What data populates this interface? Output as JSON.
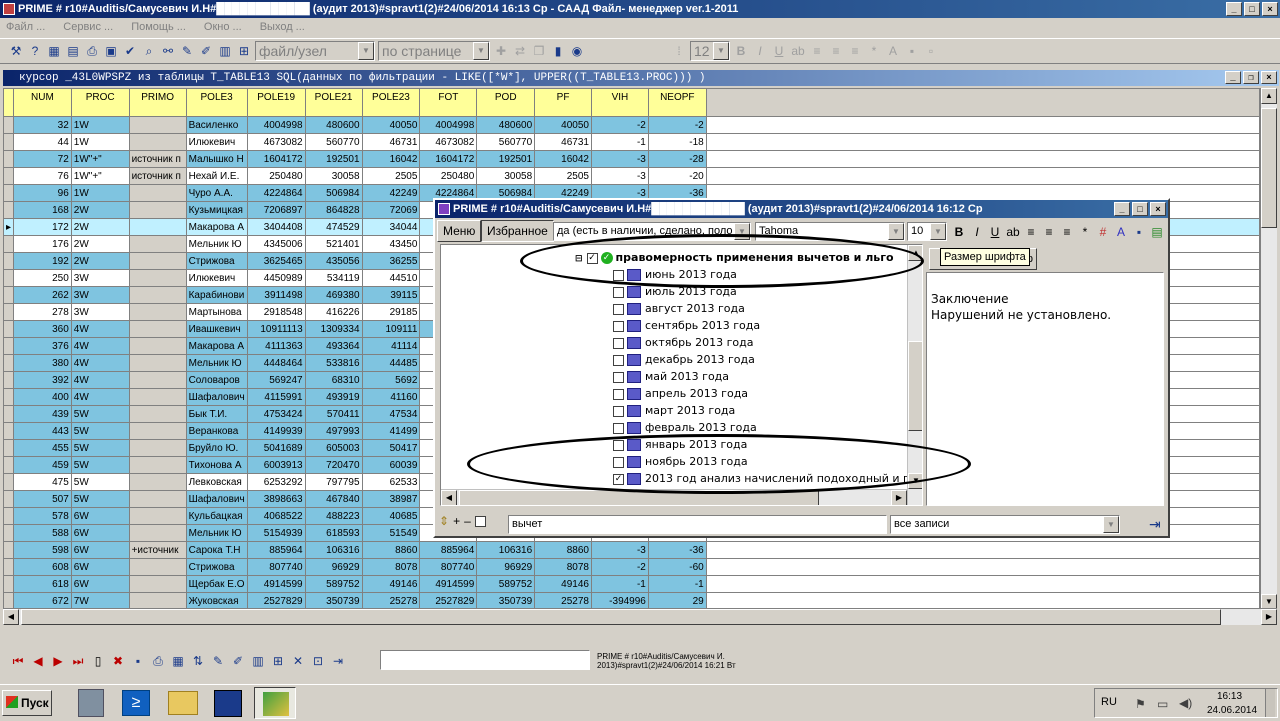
{
  "window": {
    "title": "PRIME # r10#Auditis/Самусевич И.Н#████████████ (аудит 2013)#spravt1(2)#24/06/2014 16:13 Ср - СААД Файл- менеджер ver.1-2011"
  },
  "menu": [
    "Файл ...",
    "Сервис ...",
    "Помощь ...",
    "Окно ...",
    "Выход ..."
  ],
  "toolbar": {
    "file_node": "файл/узел",
    "by_page": "по странице",
    "font_size": "12"
  },
  "mdi": {
    "title": "курсор _43L0WPSPZ из таблицы T_TABLE13 SQL(данных по фильтрации - LIKE([*W*], UPPER((T_TABLE13.PROC))) )"
  },
  "grid": {
    "columns": [
      "NUM",
      "PROC",
      "PRIMO",
      "POLE3",
      "POLE19",
      "POLE21",
      "POLE23",
      "FOT",
      "POD",
      "PF",
      "VIH",
      "NEOPF"
    ],
    "rows": [
      [
        "32",
        "1W",
        "",
        "Василенко",
        "4004998",
        "480600",
        "40050",
        "4004998",
        "480600",
        "40050",
        "-2",
        "-2"
      ],
      [
        "44",
        "1W",
        "",
        "Илюкевич",
        "4673082",
        "560770",
        "46731",
        "4673082",
        "560770",
        "46731",
        "-1",
        "-18"
      ],
      [
        "72",
        "1W\"+\"",
        "источник п",
        "Малышко Н",
        "1604172",
        "192501",
        "16042",
        "1604172",
        "192501",
        "16042",
        "-3",
        "-28"
      ],
      [
        "76",
        "1W\"+\"",
        "источник п",
        "Нехай И.Е.",
        "250480",
        "30058",
        "2505",
        "250480",
        "30058",
        "2505",
        "-3",
        "-20"
      ],
      [
        "96",
        "1W",
        "",
        "Чуро А.А.",
        "4224864",
        "506984",
        "42249",
        "4224864",
        "506984",
        "42249",
        "-3",
        "-36"
      ],
      [
        "168",
        "2W",
        "",
        "Кузьмицкая",
        "7206897",
        "864828",
        "72069",
        "",
        "",
        "",
        "",
        ""
      ],
      [
        "172",
        "2W",
        "",
        "Макарова А",
        "3404408",
        "474529",
        "34044",
        "",
        "",
        "",
        "",
        ""
      ],
      [
        "176",
        "2W",
        "",
        "Мельник Ю",
        "4345006",
        "521401",
        "43450",
        "",
        "",
        "",
        "",
        ""
      ],
      [
        "192",
        "2W",
        "",
        "Стрижова",
        "3625465",
        "435056",
        "36255",
        "",
        "",
        "",
        "",
        ""
      ],
      [
        "250",
        "3W",
        "",
        "Илюкевич",
        "4450989",
        "534119",
        "44510",
        "",
        "",
        "",
        "",
        ""
      ],
      [
        "262",
        "3W",
        "",
        "Карабинови",
        "3911498",
        "469380",
        "39115",
        "",
        "",
        "",
        "",
        ""
      ],
      [
        "278",
        "3W",
        "",
        "Мартынова",
        "2918548",
        "416226",
        "29185",
        "",
        "",
        "",
        "",
        ""
      ],
      [
        "360",
        "4W",
        "",
        "Ивашкевич",
        "10911113",
        "1309334",
        "109111",
        "1",
        "",
        "",
        "",
        ""
      ],
      [
        "376",
        "4W",
        "",
        "Макарова А",
        "4111363",
        "493364",
        "41114",
        "",
        "",
        "",
        "",
        ""
      ],
      [
        "380",
        "4W",
        "",
        "Мельник Ю",
        "4448464",
        "533816",
        "44485",
        "",
        "",
        "",
        "",
        ""
      ],
      [
        "392",
        "4W",
        "",
        "Соловаров",
        "569247",
        "68310",
        "5692",
        "",
        "",
        "",
        "",
        ""
      ],
      [
        "400",
        "4W",
        "",
        "Шафалович",
        "4115991",
        "493919",
        "41160",
        "",
        "",
        "",
        "",
        ""
      ],
      [
        "439",
        "5W",
        "",
        "Бык Т.И.",
        "4753424",
        "570411",
        "47534",
        "",
        "",
        "",
        "",
        ""
      ],
      [
        "443",
        "5W",
        "",
        "Веранкова",
        "4149939",
        "497993",
        "41499",
        "",
        "",
        "",
        "",
        ""
      ],
      [
        "455",
        "5W",
        "",
        "Бруйло Ю.",
        "5041689",
        "605003",
        "50417",
        "",
        "",
        "",
        "",
        ""
      ],
      [
        "459",
        "5W",
        "",
        "Тихонова А",
        "6003913",
        "720470",
        "60039",
        "",
        "",
        "",
        "",
        ""
      ],
      [
        "475",
        "5W",
        "",
        "Левковская",
        "6253292",
        "797795",
        "62533",
        "",
        "",
        "",
        "",
        ""
      ],
      [
        "507",
        "5W",
        "",
        "Шафалович",
        "3898663",
        "467840",
        "38987",
        "",
        "",
        "",
        "",
        ""
      ],
      [
        "578",
        "6W",
        "",
        "Кульбацкая",
        "4068522",
        "488223",
        "40685",
        "",
        "",
        "",
        "",
        ""
      ],
      [
        "588",
        "6W",
        "",
        "Мельник Ю",
        "5154939",
        "618593",
        "51549",
        "",
        "",
        "",
        "",
        ""
      ],
      [
        "598",
        "6W",
        "+источник",
        "Сарока Т.Н",
        "885964",
        "106316",
        "8860",
        "885964",
        "106316",
        "8860",
        "-3",
        "-36"
      ],
      [
        "608",
        "6W",
        "",
        "Стрижова",
        "807740",
        "96929",
        "8078",
        "807740",
        "96929",
        "8078",
        "-2",
        "-60"
      ],
      [
        "618",
        "6W",
        "",
        "Щербак Е.О",
        "4914599",
        "589752",
        "49146",
        "4914599",
        "589752",
        "49146",
        "-1",
        "-1"
      ],
      [
        "672",
        "7W",
        "",
        "Жуковская",
        "2527829",
        "350739",
        "25278",
        "2527829",
        "350739",
        "25278",
        "-394996",
        "29"
      ]
    ]
  },
  "dialog": {
    "title": "PRIME # r10#Auditis/Самусевич И.Н#████████████ (аудит 2013)#spravt1(2)#24/06/2014 16:12 Ср",
    "tab_menu": "Меню",
    "tab_favorites": "Избранное",
    "combo_value": "да (есть в наличии, сделано, поло",
    "font_name": "Tahoma",
    "font_size": "10",
    "tooltip": "Размер шрифта",
    "tab_preview": "вр",
    "tree_root": "правомерность применения вычетов и льго",
    "tree_items": [
      "июнь 2013 года",
      "июль 2013 года",
      "август 2013 года",
      "сентябрь 2013 года",
      "октябрь 2013 года",
      "декабрь 2013 года",
      "май 2013 года",
      "апрель 2013 года",
      "март 2013 года",
      "февраль 2013 года",
      "январь 2013 года",
      "ноябрь 2013 года",
      "2013 год анализ начислений подоходный и пф"
    ],
    "text_line1": "Заключение",
    "text_line2": "Нарушений не установлено.",
    "search_value": "вычет",
    "filter_value": "все записи",
    "add_symbol": "+",
    "remove_symbol": "–"
  },
  "status": {
    "line1": "PRIME # r10#Auditis/Самусевич И.",
    "line2": "2013)#spravt1(2)#24/06/2014 16:21 Вт"
  },
  "taskbar": {
    "start": "Пуск",
    "lang": "RU",
    "time": "16:13",
    "date": "24.06.2014"
  }
}
